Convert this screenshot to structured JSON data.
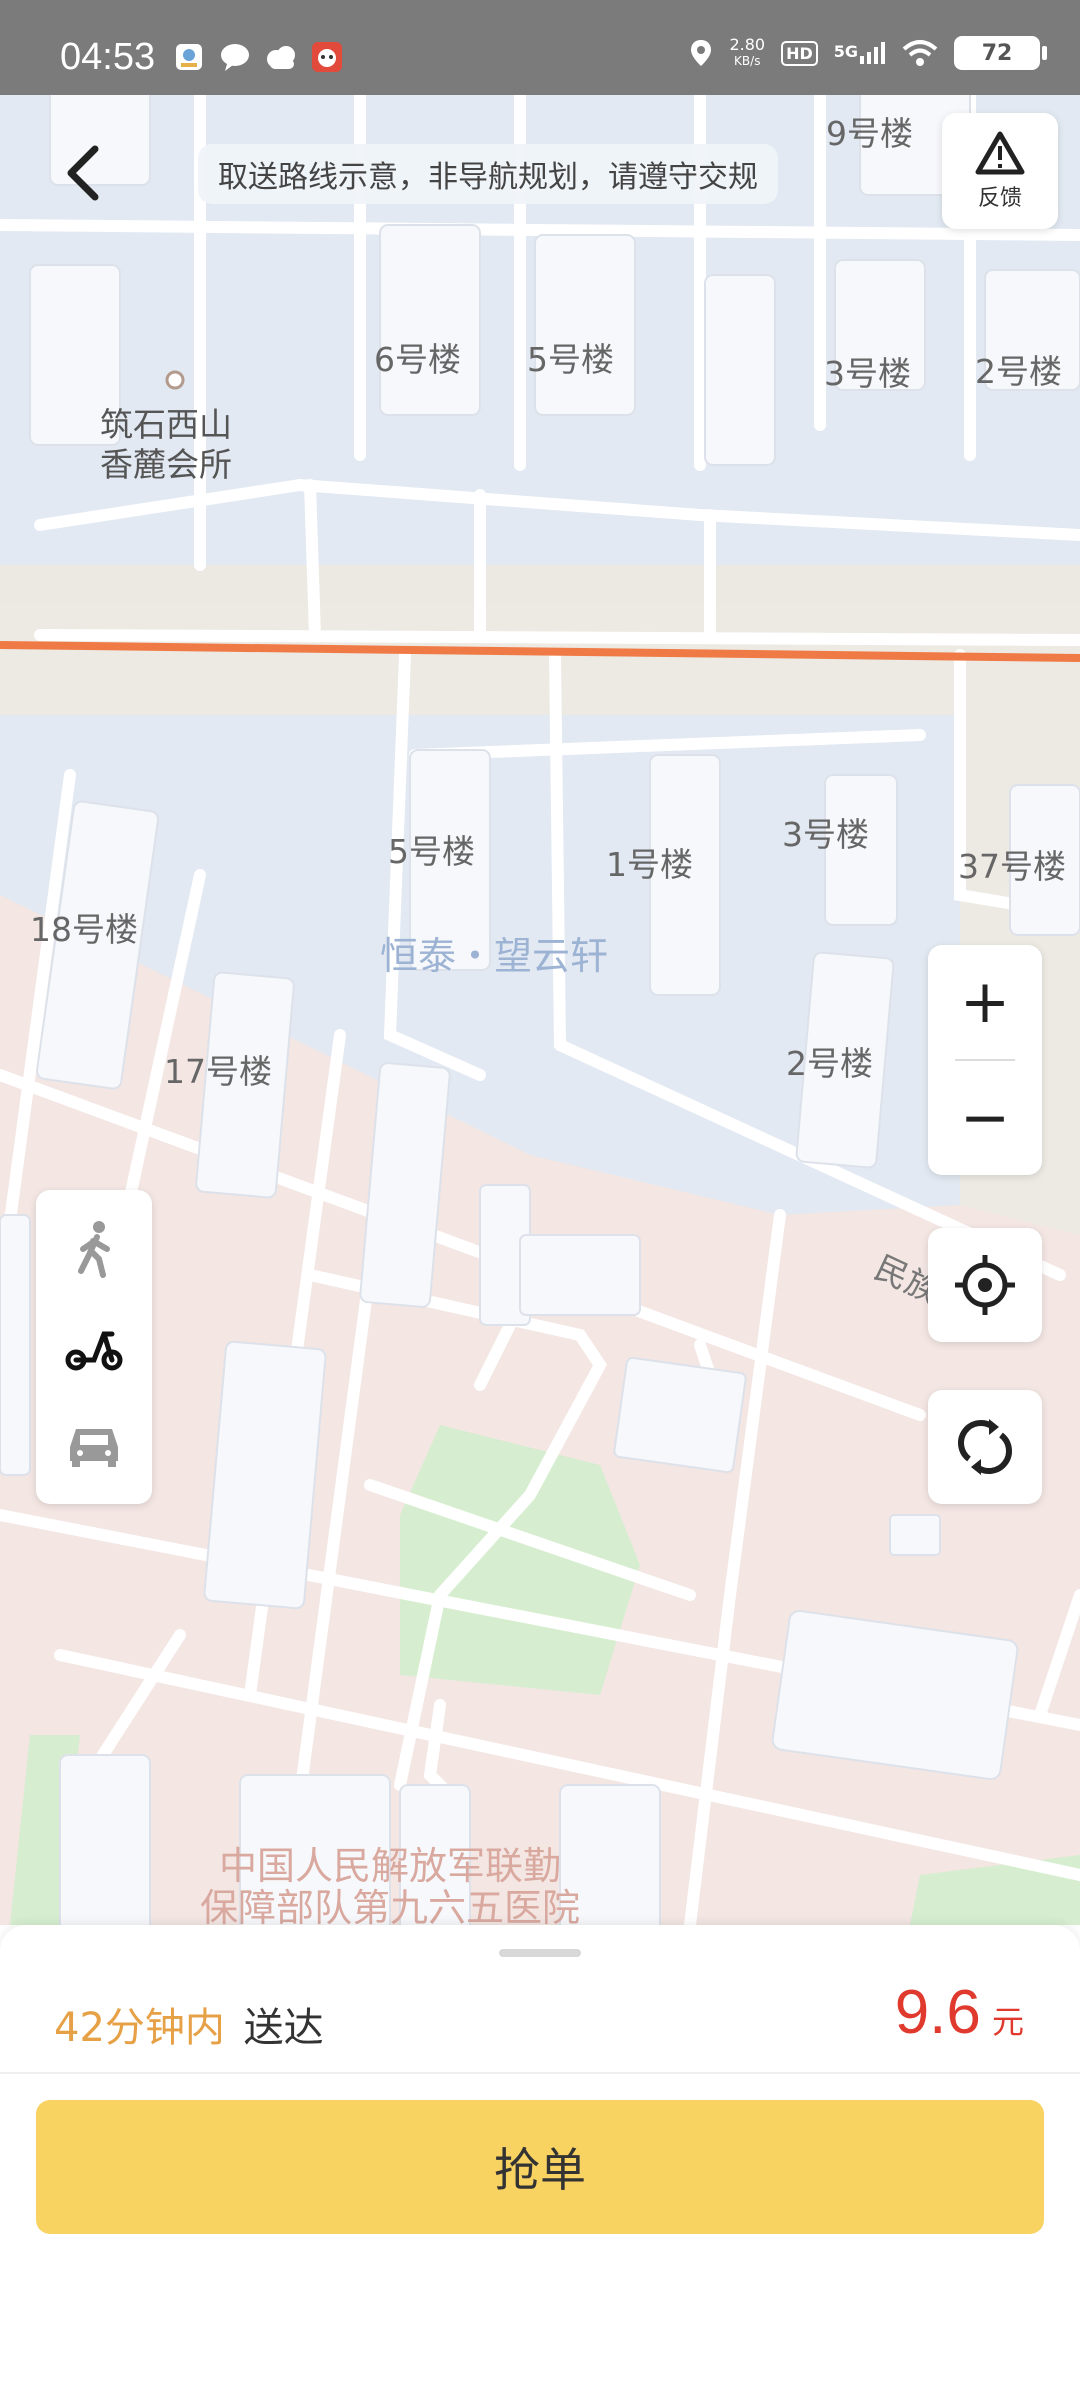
{
  "status_bar": {
    "time": "04:53",
    "net_speed_value": "2.80",
    "net_speed_unit": "KB/s",
    "hd": "HD",
    "signal": "5G",
    "battery": "72"
  },
  "map": {
    "notice": "取送路线示意，非导航规划，请遵守交规",
    "feedback_label": "反馈",
    "poi": {
      "line1": "筑石西山",
      "line2": "香麓会所"
    },
    "compound": "恒泰・望云轩",
    "hospital": {
      "line1": "中国人民解放军联勤",
      "line2": "保障部队第九六五医院"
    },
    "buildings": {
      "b9": "9号楼",
      "b6": "6号楼",
      "b5a": "5号楼",
      "b3a": "3号楼",
      "b2a": "2号楼",
      "b5b": "5号楼",
      "b1": "1号楼",
      "b3b": "3号楼",
      "b37": "37号楼",
      "b18": "18号楼",
      "b17": "17号楼",
      "b2b": "2号楼"
    },
    "road_label": "民族",
    "zoom_in": "+",
    "zoom_out": "−",
    "route_color": "#f07a45"
  },
  "modes": [
    "walk-icon",
    "scooter-icon",
    "car-icon"
  ],
  "order": {
    "eta_time": "42分钟内",
    "eta_done": "送达",
    "price": "9.6",
    "price_unit": "元",
    "grab_label": "抢单"
  }
}
